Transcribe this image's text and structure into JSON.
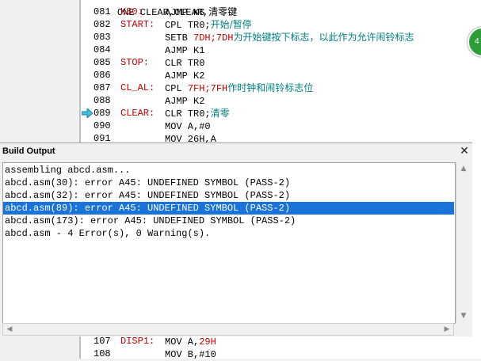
{
  "editor": {
    "top_fragment": "ONE CLEAR,CLEAR,清零键",
    "lines": [
      {
        "num": "081",
        "label": "KS0:",
        "ins": "AJMP KS",
        "arg_red": "",
        "comment": ""
      },
      {
        "num": "082",
        "label": "START:",
        "ins": "CPL TR0;",
        "arg_red": "",
        "comment": "开始/暂停"
      },
      {
        "num": "083",
        "label": "",
        "ins": "SETB ",
        "arg_red": "7DH;7DH",
        "comment": "为开始键按下标志，以此作为允许闹铃标志"
      },
      {
        "num": "084",
        "label": "",
        "ins": "AJMP K1",
        "arg_red": "",
        "comment": ""
      },
      {
        "num": "085",
        "label": "STOP:",
        "ins": "CLR TR0",
        "arg_red": "",
        "comment": ""
      },
      {
        "num": "086",
        "label": "",
        "ins": "AJMP K2",
        "arg_red": "",
        "comment": ""
      },
      {
        "num": "087",
        "label": "CL_AL:",
        "ins": "CPL ",
        "arg_red": "7FH;7FH",
        "comment": "作时钟和闹铃标志位"
      },
      {
        "num": "088",
        "label": "",
        "ins": "AJMP K2",
        "arg_red": "",
        "comment": ""
      },
      {
        "num": "089",
        "label": "CLEAR:",
        "ins": "CLR TR0;",
        "arg_red": "",
        "comment": "清零"
      },
      {
        "num": "090",
        "label": "",
        "ins": "MOV A,#0",
        "arg_red": "",
        "comment": ""
      },
      {
        "num": "091",
        "label": "",
        "ins": "MOV 26H,A",
        "arg_red": "",
        "comment": ""
      }
    ],
    "bottom_lines": [
      {
        "num": "107",
        "label": "DISP1:",
        "ins": "MOV A,",
        "arg_red": "29H",
        "comment": ""
      },
      {
        "num": "108",
        "label": "",
        "ins": "MOV B,#10",
        "arg_red": "",
        "comment": ""
      }
    ],
    "badge_text": "4"
  },
  "build_output": {
    "title": "Build Output",
    "close_label": "✕",
    "lines": [
      "assembling abcd.asm...",
      "abcd.asm(30): error A45: UNDEFINED SYMBOL (PASS-2)",
      "abcd.asm(32): error A45: UNDEFINED SYMBOL (PASS-2)",
      "abcd.asm(89): error A45: UNDEFINED SYMBOL (PASS-2)",
      "abcd.asm(173): error A45: UNDEFINED SYMBOL (PASS-2)",
      "abcd.asm - 4 Error(s), 0 Warning(s)."
    ],
    "selected_index": 3
  },
  "colors": {
    "selection": "#1a73d9",
    "label_red": "#c00000",
    "comment_teal": "#008080"
  }
}
